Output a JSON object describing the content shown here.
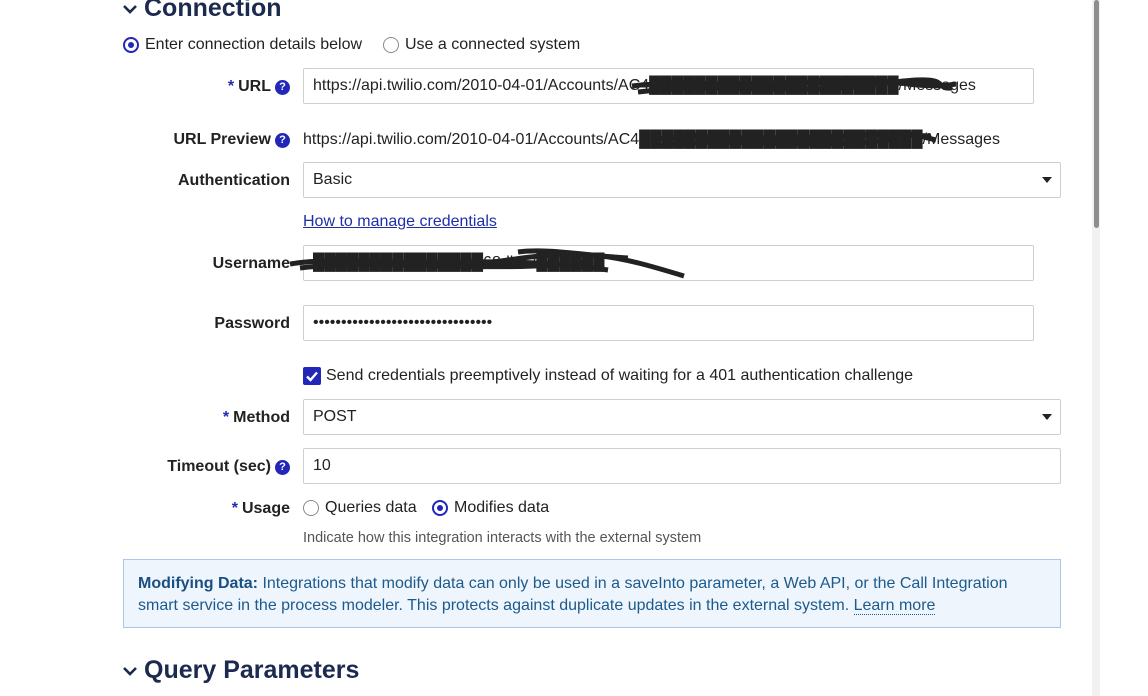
{
  "sections": {
    "connection_title": "Connection",
    "query_params_title": "Query Parameters"
  },
  "connection_mode": {
    "option_enter": "Enter connection details below",
    "option_system": "Use a connected system",
    "selected": "enter"
  },
  "url": {
    "required_mark": "*",
    "label": "URL",
    "value": "https://api.twilio.com/2010-04-01/Accounts/AC4██████████████████████/Messages"
  },
  "url_preview": {
    "label": "URL Preview",
    "value": "https://api.twilio.com/2010-04-01/Accounts/AC4█████████████████████████/Messages"
  },
  "authentication": {
    "label": "Authentication",
    "value": "Basic",
    "manage_link": "How to manage credentials"
  },
  "username": {
    "label": "Username",
    "value": "███████████████68dba2██████"
  },
  "password": {
    "label": "Password",
    "value": "••••••••••••••••••••••••••••••••"
  },
  "preemptive": {
    "label": "Send credentials preemptively instead of waiting for a 401 authentication challenge",
    "checked": true
  },
  "method": {
    "required_mark": "*",
    "label": "Method",
    "value": "POST"
  },
  "timeout": {
    "label": "Timeout (sec)",
    "value": "10"
  },
  "usage": {
    "required_mark": "*",
    "label": "Usage",
    "option_queries": "Queries data",
    "option_modifies": "Modifies data",
    "selected": "modifies",
    "hint": "Indicate how this integration interacts with the external system"
  },
  "info_box": {
    "title": "Modifying Data:",
    "text": " Integrations that modify data can only be used in a saveInto parameter, a Web API, or the Call Integration smart service in the process modeler. This protects against duplicate updates in the external system. ",
    "link": "Learn more"
  },
  "colors": {
    "accent": "#2327b8",
    "section_title": "#1b2a4e",
    "info_bg": "#eef5fd",
    "info_border": "#a9c9ea",
    "info_text": "#1d5a8c"
  },
  "icons": [
    "chevron-down-icon",
    "help-icon",
    "select-caret-icon",
    "checkmark-icon"
  ]
}
